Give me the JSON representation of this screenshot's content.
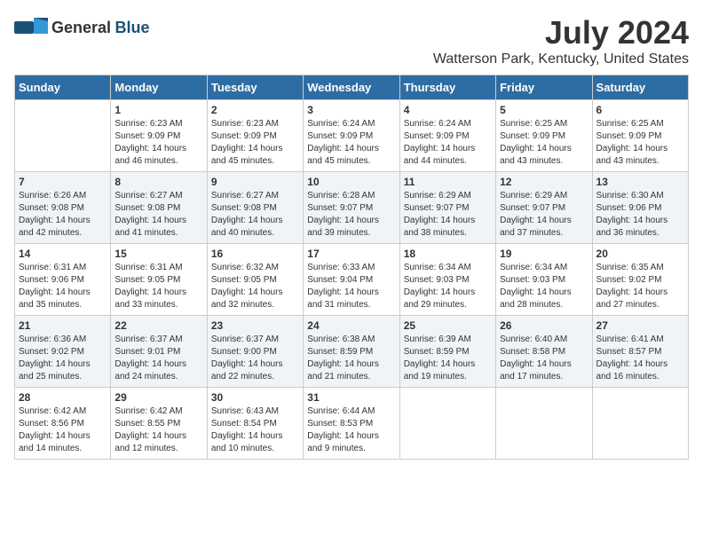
{
  "header": {
    "logo_general": "General",
    "logo_blue": "Blue",
    "month": "July 2024",
    "location": "Watterson Park, Kentucky, United States"
  },
  "weekdays": [
    "Sunday",
    "Monday",
    "Tuesday",
    "Wednesday",
    "Thursday",
    "Friday",
    "Saturday"
  ],
  "weeks": [
    [
      {
        "day": "",
        "info": ""
      },
      {
        "day": "1",
        "info": "Sunrise: 6:23 AM\nSunset: 9:09 PM\nDaylight: 14 hours and 46 minutes."
      },
      {
        "day": "2",
        "info": "Sunrise: 6:23 AM\nSunset: 9:09 PM\nDaylight: 14 hours and 45 minutes."
      },
      {
        "day": "3",
        "info": "Sunrise: 6:24 AM\nSunset: 9:09 PM\nDaylight: 14 hours and 45 minutes."
      },
      {
        "day": "4",
        "info": "Sunrise: 6:24 AM\nSunset: 9:09 PM\nDaylight: 14 hours and 44 minutes."
      },
      {
        "day": "5",
        "info": "Sunrise: 6:25 AM\nSunset: 9:09 PM\nDaylight: 14 hours and 43 minutes."
      },
      {
        "day": "6",
        "info": "Sunrise: 6:25 AM\nSunset: 9:09 PM\nDaylight: 14 hours and 43 minutes."
      }
    ],
    [
      {
        "day": "7",
        "info": "Sunrise: 6:26 AM\nSunset: 9:08 PM\nDaylight: 14 hours and 42 minutes."
      },
      {
        "day": "8",
        "info": "Sunrise: 6:27 AM\nSunset: 9:08 PM\nDaylight: 14 hours and 41 minutes."
      },
      {
        "day": "9",
        "info": "Sunrise: 6:27 AM\nSunset: 9:08 PM\nDaylight: 14 hours and 40 minutes."
      },
      {
        "day": "10",
        "info": "Sunrise: 6:28 AM\nSunset: 9:07 PM\nDaylight: 14 hours and 39 minutes."
      },
      {
        "day": "11",
        "info": "Sunrise: 6:29 AM\nSunset: 9:07 PM\nDaylight: 14 hours and 38 minutes."
      },
      {
        "day": "12",
        "info": "Sunrise: 6:29 AM\nSunset: 9:07 PM\nDaylight: 14 hours and 37 minutes."
      },
      {
        "day": "13",
        "info": "Sunrise: 6:30 AM\nSunset: 9:06 PM\nDaylight: 14 hours and 36 minutes."
      }
    ],
    [
      {
        "day": "14",
        "info": "Sunrise: 6:31 AM\nSunset: 9:06 PM\nDaylight: 14 hours and 35 minutes."
      },
      {
        "day": "15",
        "info": "Sunrise: 6:31 AM\nSunset: 9:05 PM\nDaylight: 14 hours and 33 minutes."
      },
      {
        "day": "16",
        "info": "Sunrise: 6:32 AM\nSunset: 9:05 PM\nDaylight: 14 hours and 32 minutes."
      },
      {
        "day": "17",
        "info": "Sunrise: 6:33 AM\nSunset: 9:04 PM\nDaylight: 14 hours and 31 minutes."
      },
      {
        "day": "18",
        "info": "Sunrise: 6:34 AM\nSunset: 9:03 PM\nDaylight: 14 hours and 29 minutes."
      },
      {
        "day": "19",
        "info": "Sunrise: 6:34 AM\nSunset: 9:03 PM\nDaylight: 14 hours and 28 minutes."
      },
      {
        "day": "20",
        "info": "Sunrise: 6:35 AM\nSunset: 9:02 PM\nDaylight: 14 hours and 27 minutes."
      }
    ],
    [
      {
        "day": "21",
        "info": "Sunrise: 6:36 AM\nSunset: 9:02 PM\nDaylight: 14 hours and 25 minutes."
      },
      {
        "day": "22",
        "info": "Sunrise: 6:37 AM\nSunset: 9:01 PM\nDaylight: 14 hours and 24 minutes."
      },
      {
        "day": "23",
        "info": "Sunrise: 6:37 AM\nSunset: 9:00 PM\nDaylight: 14 hours and 22 minutes."
      },
      {
        "day": "24",
        "info": "Sunrise: 6:38 AM\nSunset: 8:59 PM\nDaylight: 14 hours and 21 minutes."
      },
      {
        "day": "25",
        "info": "Sunrise: 6:39 AM\nSunset: 8:59 PM\nDaylight: 14 hours and 19 minutes."
      },
      {
        "day": "26",
        "info": "Sunrise: 6:40 AM\nSunset: 8:58 PM\nDaylight: 14 hours and 17 minutes."
      },
      {
        "day": "27",
        "info": "Sunrise: 6:41 AM\nSunset: 8:57 PM\nDaylight: 14 hours and 16 minutes."
      }
    ],
    [
      {
        "day": "28",
        "info": "Sunrise: 6:42 AM\nSunset: 8:56 PM\nDaylight: 14 hours and 14 minutes."
      },
      {
        "day": "29",
        "info": "Sunrise: 6:42 AM\nSunset: 8:55 PM\nDaylight: 14 hours and 12 minutes."
      },
      {
        "day": "30",
        "info": "Sunrise: 6:43 AM\nSunset: 8:54 PM\nDaylight: 14 hours and 10 minutes."
      },
      {
        "day": "31",
        "info": "Sunrise: 6:44 AM\nSunset: 8:53 PM\nDaylight: 14 hours and 9 minutes."
      },
      {
        "day": "",
        "info": ""
      },
      {
        "day": "",
        "info": ""
      },
      {
        "day": "",
        "info": ""
      }
    ]
  ]
}
